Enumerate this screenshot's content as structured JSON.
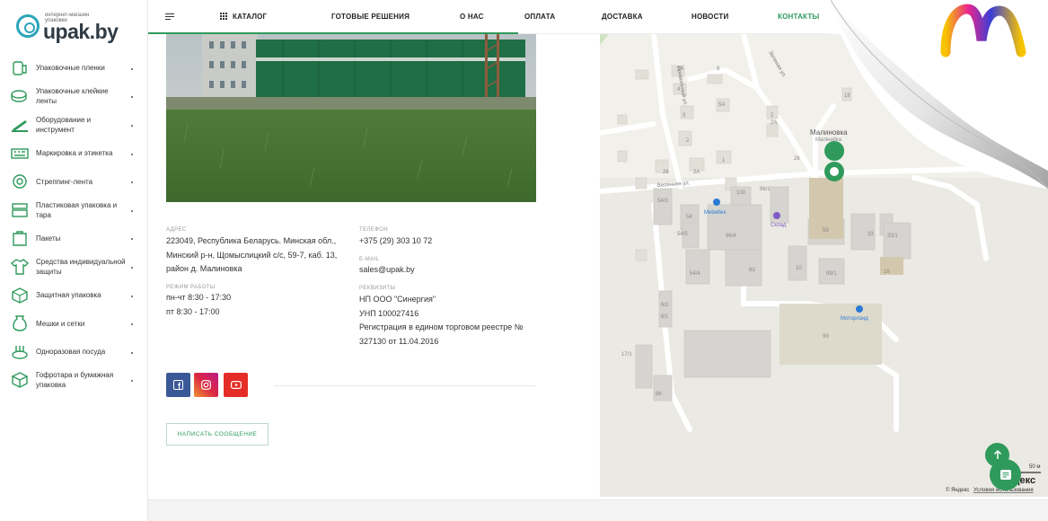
{
  "logo": {
    "small_text": "интернет-магазин упаковки",
    "brand": "upak.by"
  },
  "sidebar": {
    "items": [
      {
        "label": "Упаковочные пленки",
        "icon": "film-roll-icon"
      },
      {
        "label": "Упаковочные клейкие ленты",
        "icon": "tape-roll-icon"
      },
      {
        "label": "Оборудование и инструмент",
        "icon": "tool-icon"
      },
      {
        "label": "Маркировка и этикетка",
        "icon": "label-printer-icon"
      },
      {
        "label": "Стреппинг-лента",
        "icon": "strapping-icon"
      },
      {
        "label": "Пластиковая упаковка и тара",
        "icon": "container-icon"
      },
      {
        "label": "Пакеты",
        "icon": "bag-icon"
      },
      {
        "label": "Средства индивидуальной защиты",
        "icon": "protective-clothing-icon"
      },
      {
        "label": "Защитная упаковка",
        "icon": "protective-pack-icon"
      },
      {
        "label": "Мешки и сетки",
        "icon": "sack-icon"
      },
      {
        "label": "Одноразовая посуда",
        "icon": "tableware-icon"
      },
      {
        "label": "Гофротара и бумажная упаковка",
        "icon": "cardboard-box-icon"
      }
    ]
  },
  "nav": {
    "catalog": "КАТАЛОГ",
    "solutions": "ГОТОВЫЕ РЕШЕНИЯ",
    "about": "О НАС",
    "payment": "ОПЛАТА",
    "delivery": "ДОСТАВКА",
    "news": "НОВОСТИ",
    "contacts": "КОНТАКТЫ"
  },
  "contacts": {
    "address_label": "АДРЕС",
    "address_lines": [
      "223049, Республика Беларусь. Минская обл.,",
      "Минский р-н, Щомыслицкий с/с, 59-7, каб. 13,",
      "район д. Малиновка"
    ],
    "hours_label": "РЕЖИМ РАБОТЫ",
    "hours_lines": [
      "пн-чт 8:30 - 17:30",
      "пт 8:30 - 17:00"
    ],
    "phone_label": "ТЕЛЕФОН",
    "phone": "+375 (29) 303 10 72",
    "email_label": "E-MAIL",
    "email": "sales@upak.by",
    "requisites_label": "РЕКВИЗИТЫ",
    "requisites_lines": [
      "НП ООО \"Синергия\"",
      "УНП 100027416",
      "Регистрация в едином торговом реестре №",
      "327130 от 11.04.2016"
    ]
  },
  "social": [
    {
      "icon": "facebook-icon",
      "color": "#3b5998"
    },
    {
      "icon": "instagram-icon",
      "color": "#c13584"
    },
    {
      "icon": "youtube-icon",
      "color": "#e52d27"
    }
  ],
  "message_button": "НАПИСАТЬ СООБЩЕНИЕ",
  "map": {
    "district": "Малиновка",
    "district_by": "Малінаўка",
    "street1": "Весенняя ул.",
    "street2": "Приволь­ный ул.",
    "street3": "Зеленая ул.",
    "poi1": "Mebeltex",
    "poi2": "Склад",
    "poi3": "Моторлэнд",
    "scale": "50 м",
    "copyright": "© Яндекс",
    "terms": "Условия использования",
    "brand": "Яндекс",
    "numbers": [
      "18",
      "2",
      "2А",
      "26",
      "8",
      "9А",
      "4",
      "5А",
      "3",
      "1",
      "2",
      "26",
      "2А",
      "54/3",
      "54",
      "100",
      "96/1",
      "59",
      "33",
      "33/1",
      "54/5",
      "96/4",
      "83",
      "10",
      "99/1",
      "16",
      "54/4",
      "6/2",
      "6/1",
      "99",
      "17/1",
      "86"
    ]
  },
  "colors": {
    "accent": "#2f9a5b",
    "text": "#333333"
  }
}
